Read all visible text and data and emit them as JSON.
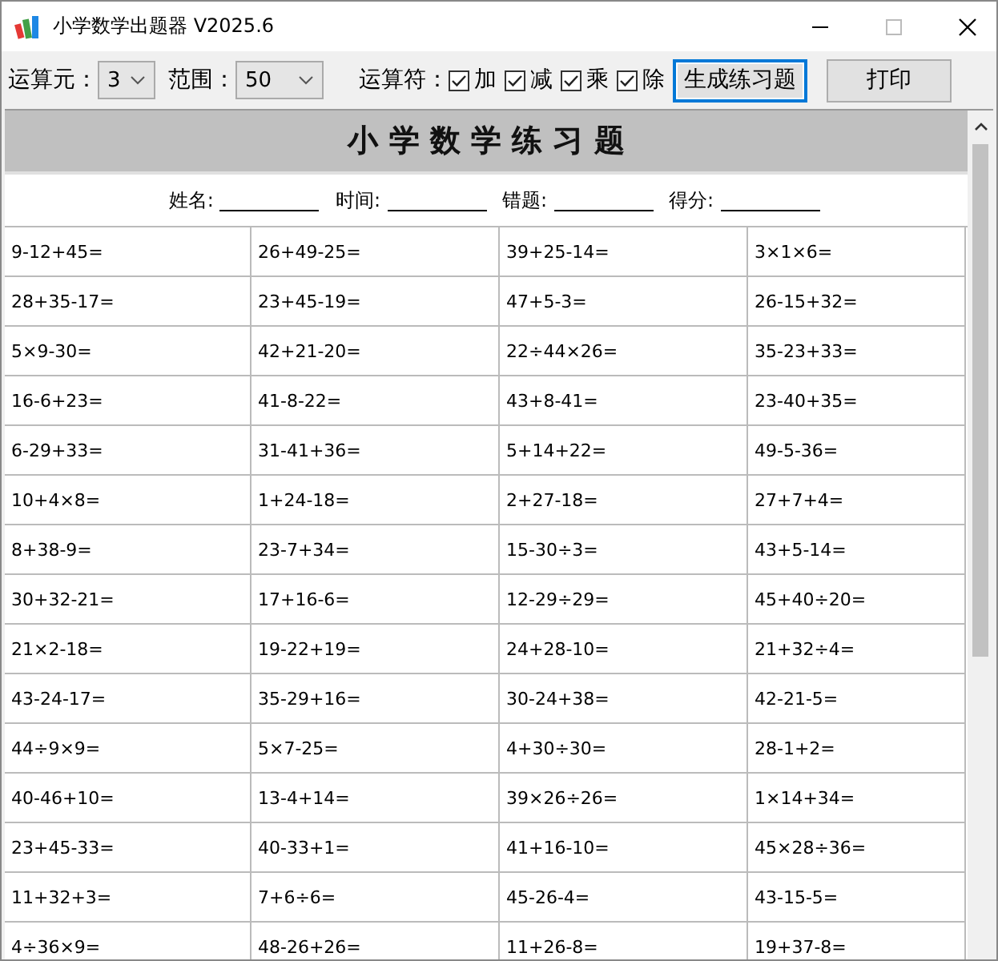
{
  "window": {
    "title": "小学数学出题器 V2025.6"
  },
  "toolbar": {
    "operand_count": {
      "label": "运算元：",
      "value": "3"
    },
    "range": {
      "label": "范围：",
      "value": "50"
    },
    "operators_label": "运算符：",
    "operators": [
      {
        "label": "加",
        "checked": true
      },
      {
        "label": "减",
        "checked": true
      },
      {
        "label": "乘",
        "checked": true
      },
      {
        "label": "除",
        "checked": true
      }
    ],
    "buttons": [
      {
        "label": "生成练习题",
        "focused": true
      },
      {
        "label": "打印",
        "focused": false
      }
    ]
  },
  "sheet": {
    "title": "小 学 数 学 练 习 题",
    "fields": [
      "姓名:",
      "时间:",
      "错题:",
      "得分:"
    ],
    "rows": [
      [
        "9-12+45=",
        "26+49-25=",
        "39+25-14=",
        "3×1×6="
      ],
      [
        "28+35-17=",
        "23+45-19=",
        "47+5-3=",
        "26-15+32="
      ],
      [
        "5×9-30=",
        "42+21-20=",
        "22÷44×26=",
        "35-23+33="
      ],
      [
        "16-6+23=",
        "41-8-22=",
        "43+8-41=",
        "23-40+35="
      ],
      [
        "6-29+33=",
        "31-41+36=",
        "5+14+22=",
        "49-5-36="
      ],
      [
        "10+4×8=",
        "1+24-18=",
        "2+27-18=",
        "27+7+4="
      ],
      [
        "8+38-9=",
        "23-7+34=",
        "15-30÷3=",
        "43+5-14="
      ],
      [
        "30+32-21=",
        "17+16-6=",
        "12-29÷29=",
        "45+40÷20="
      ],
      [
        "21×2-18=",
        "19-22+19=",
        "24+28-10=",
        "21+32÷4="
      ],
      [
        "43-24-17=",
        "35-29+16=",
        "30-24+38=",
        "42-21-5="
      ],
      [
        "44÷9×9=",
        "5×7-25=",
        "4+30÷30=",
        "28-1+2="
      ],
      [
        "40-46+10=",
        "13-4+14=",
        "39×26÷26=",
        "1×14+34="
      ],
      [
        "23+45-33=",
        "40-33+1=",
        "41+16-10=",
        "45×28÷36="
      ],
      [
        "11+32+3=",
        "7+6÷6=",
        "45-26-4=",
        "43-15-5="
      ],
      [
        "4÷36×9=",
        "48-26+26=",
        "11+26-8=",
        "19+37-8="
      ]
    ]
  }
}
